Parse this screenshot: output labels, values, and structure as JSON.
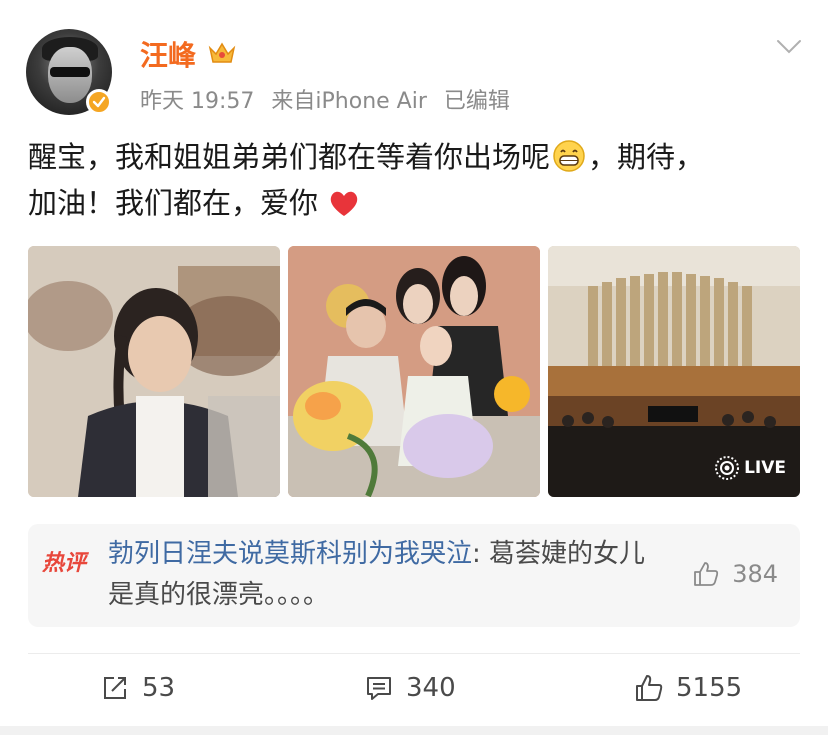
{
  "post": {
    "author": {
      "name": "汪峰",
      "time": "昨天 19:57",
      "source": "来自iPhone Air",
      "edited": "已编辑",
      "badge_icon": "crown-icon",
      "verified_icon": "verified-icon"
    },
    "text_line1": "醒宝，我和姐姐弟弟们都在等着你出场呢",
    "text_line1_tail": "，期待，",
    "text_line2": "加油！我们都在，爱你",
    "images": [
      {
        "name": "photo-girl-at-piano"
      },
      {
        "name": "photo-family-with-flowers"
      },
      {
        "name": "photo-concert-hall",
        "badge": "LIVE"
      }
    ]
  },
  "hot_comment": {
    "tag": "热评",
    "author": "勃列日涅夫说莫斯科别为我哭泣",
    "separator": ": ",
    "text": "葛荟婕的女儿是真的很漂亮。。。。",
    "likes": "384"
  },
  "actions": {
    "reposts": "53",
    "comments": "340",
    "likes": "5155"
  },
  "colors": {
    "username": "#f36a1f",
    "hot_tag": "#e8473b",
    "comment_author": "#3f6aa3",
    "verified": "#f5a623"
  }
}
